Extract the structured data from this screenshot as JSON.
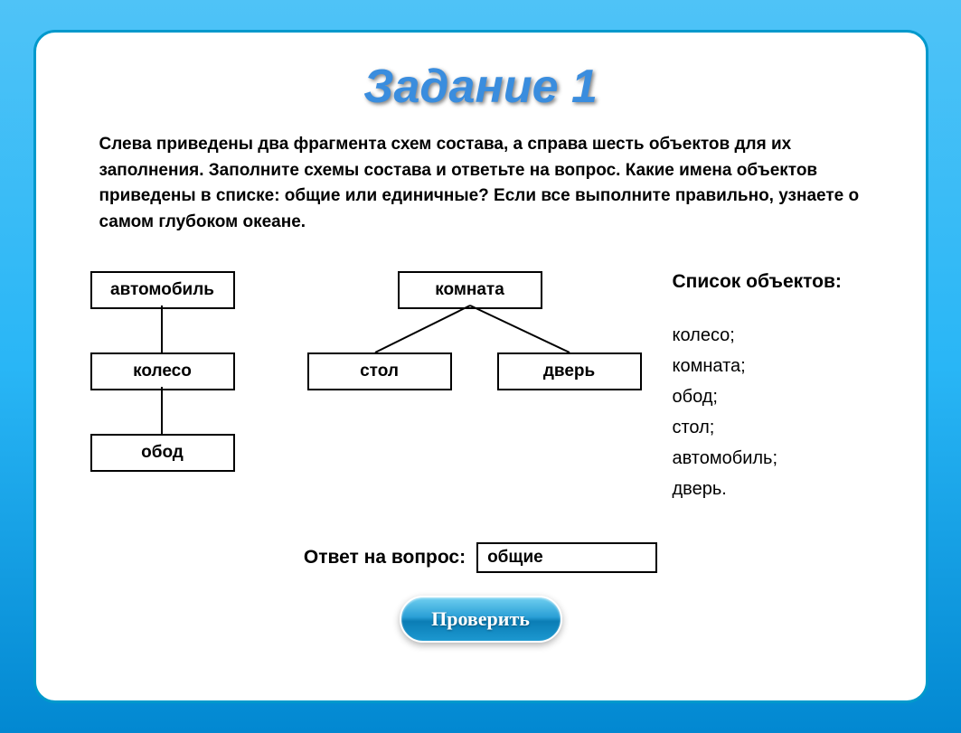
{
  "title": "Задание 1",
  "instructions": "Слева приведены два фрагмента схем состава, а справа шесть объектов для их заполнения. Заполните схемы состава и ответьте на вопрос. Какие имена объектов приведены в списке: общие или единичные? Если все выполните правильно, узнаете о самом глубоком океане.",
  "diagram": {
    "tree1": {
      "node1": "автомобиль",
      "node2": "колесо",
      "node3": "обод"
    },
    "tree2": {
      "root": "комната",
      "child1": "стол",
      "child2": "дверь"
    }
  },
  "sidebar": {
    "title": "Список объектов:",
    "items": [
      "колесо;",
      "комната;",
      "обод;",
      "стол;",
      "автомобиль;",
      "дверь."
    ]
  },
  "answer": {
    "label": "Ответ на вопрос:",
    "value": "общие"
  },
  "button": {
    "check": "Проверить"
  }
}
